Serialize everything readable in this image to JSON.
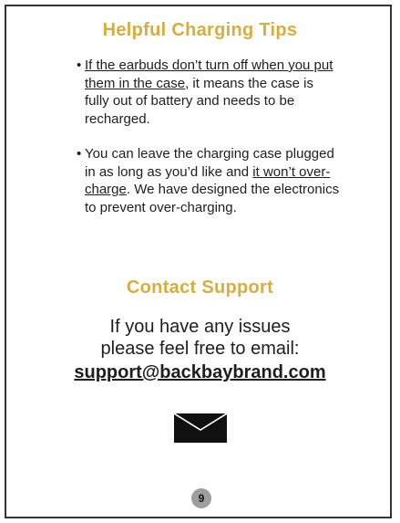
{
  "colors": {
    "heading": "#d7ae3e",
    "text": "#1e1e1e",
    "frame": "#333333",
    "page_badge": "#9e9e9e"
  },
  "tips": {
    "title": "Helpful Charging Tips",
    "items": [
      {
        "underlined": "If the earbuds don’t turn off when you put them in the case",
        "rest": ", it means the case is fully out of battery and needs to be recharged."
      },
      {
        "before": "You can leave the charging case plugged in as long as you’d like and ",
        "underlined": "it won’t over-charge",
        "after": ". We have designed the electronics to prevent over-charging."
      }
    ]
  },
  "support": {
    "title": "Contact Support",
    "line1": "If you have any issues",
    "line2": "please feel free to email:",
    "email": "support@backbaybrand.com",
    "icon": "envelope-icon"
  },
  "page_number": "9"
}
